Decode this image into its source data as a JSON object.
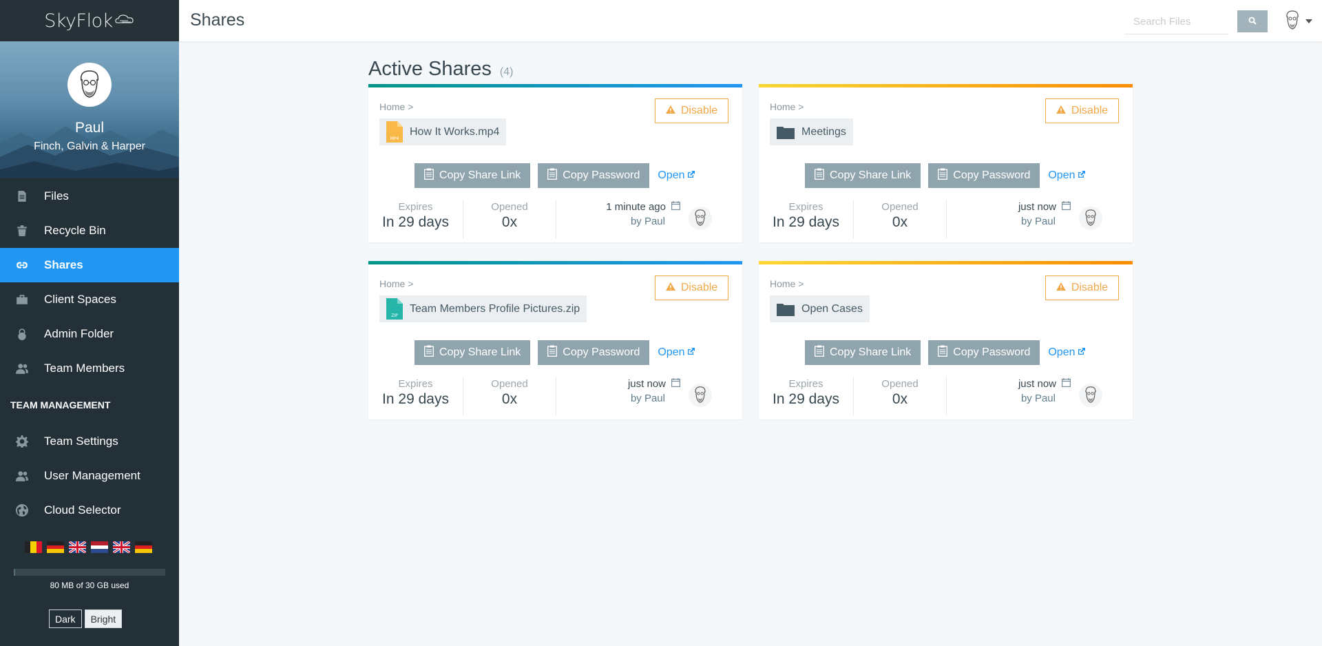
{
  "app": {
    "logo": "SkyFlok"
  },
  "profile": {
    "name": "Paul",
    "org": "Finch, Galvin & Harper"
  },
  "sidebar": {
    "items": [
      {
        "label": "Files",
        "icon": "file-icon"
      },
      {
        "label": "Recycle Bin",
        "icon": "trash-icon"
      },
      {
        "label": "Shares",
        "icon": "link-icon",
        "active": true
      },
      {
        "label": "Client Spaces",
        "icon": "briefcase-icon"
      },
      {
        "label": "Admin Folder",
        "icon": "lock-icon"
      },
      {
        "label": "Team Members",
        "icon": "users-icon"
      }
    ],
    "section_title": "TEAM MANAGEMENT",
    "management": [
      {
        "label": "Team Settings",
        "icon": "gear-icon"
      },
      {
        "label": "User Management",
        "icon": "users-icon"
      },
      {
        "label": "Cloud Selector",
        "icon": "globe-icon"
      }
    ],
    "storage": {
      "text": "80 MB of 30 GB used",
      "fraction": 0.003
    },
    "theme": {
      "dark": "Dark",
      "bright": "Bright",
      "selected": "Bright"
    }
  },
  "header": {
    "title": "Shares",
    "search_placeholder": "Search Files"
  },
  "main": {
    "heading": "Active Shares",
    "count": "(4)",
    "shares": [
      {
        "crumb": "Home >",
        "name": "How It Works.mp4",
        "type": "file",
        "file_badge": "MP4",
        "file_color": "#f9b949",
        "disable": "Disable",
        "copy_link": "Copy Share Link",
        "copy_password": "Copy Password",
        "open": "Open",
        "expires_label": "Expires",
        "expires": "In 29 days",
        "opened_label": "Opened",
        "opened": "0x",
        "when": "1 minute ago",
        "by": "by Paul"
      },
      {
        "crumb": "Home >",
        "name": "Meetings",
        "type": "folder",
        "disable": "Disable",
        "copy_link": "Copy Share Link",
        "copy_password": "Copy Password",
        "open": "Open",
        "expires_label": "Expires",
        "expires": "In 29 days",
        "opened_label": "Opened",
        "opened": "0x",
        "when": "just now",
        "by": "by Paul"
      },
      {
        "crumb": "Home >",
        "name": "Team Members Profile Pictures.zip",
        "type": "file",
        "file_badge": "ZIP",
        "file_color": "#26b5a8",
        "disable": "Disable",
        "copy_link": "Copy Share Link",
        "copy_password": "Copy Password",
        "open": "Open",
        "expires_label": "Expires",
        "expires": "In 29 days",
        "opened_label": "Opened",
        "opened": "0x",
        "when": "just now",
        "by": "by Paul"
      },
      {
        "crumb": "Home >",
        "name": "Open Cases",
        "type": "folder",
        "disable": "Disable",
        "copy_link": "Copy Share Link",
        "copy_password": "Copy Password",
        "open": "Open",
        "expires_label": "Expires",
        "expires": "In 29 days",
        "opened_label": "Opened",
        "opened": "0x",
        "when": "just now",
        "by": "by Paul"
      }
    ]
  },
  "colors": {
    "accent": "#2196f3",
    "sidebar": "#243038",
    "warning": "#f0a849",
    "button_grey": "#90a4ae"
  }
}
